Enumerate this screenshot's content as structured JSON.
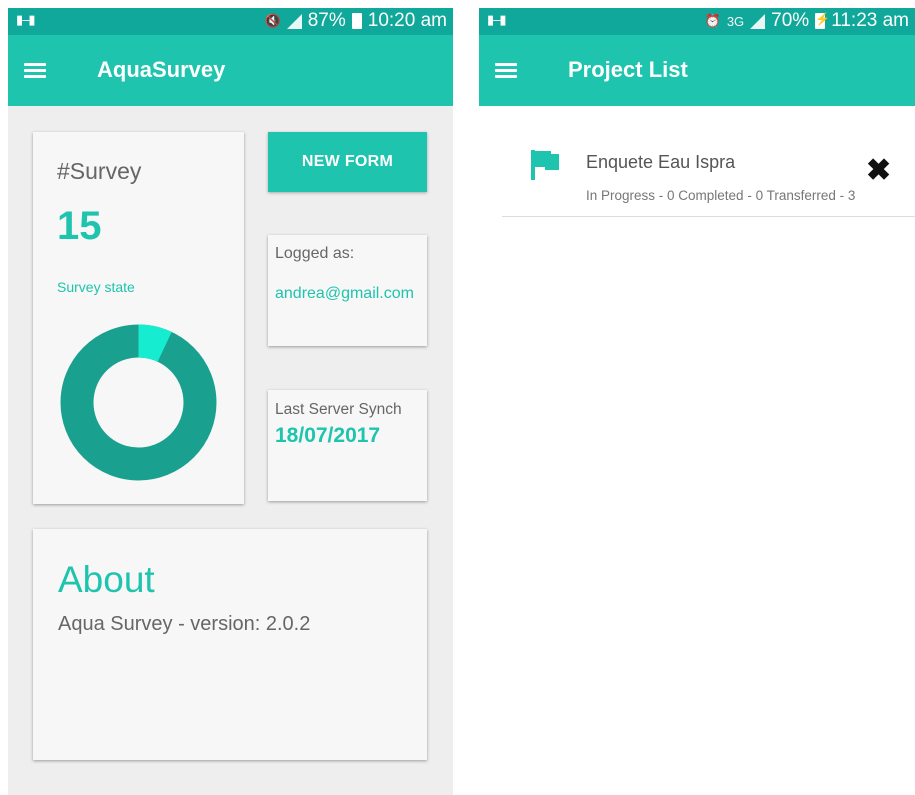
{
  "left_screen": {
    "status_bar": {
      "battery": "87%",
      "time": "10:20 am"
    },
    "app_bar": {
      "title": "AquaSurvey"
    },
    "survey_card": {
      "label": "#Survey",
      "count": "15",
      "state_label": "Survey state",
      "chart_fraction_highlight": 0.07
    },
    "new_form_label": "NEW FORM",
    "logged_card": {
      "label": "Logged as:",
      "email": "andrea@gmail.com"
    },
    "synch_card": {
      "label": "Last Server Synch",
      "date": "18/07/2017"
    },
    "about_card": {
      "title": "About",
      "version": "Aqua Survey - version: 2.0.2"
    }
  },
  "right_screen": {
    "status_bar": {
      "battery": "70%",
      "time": "11:23 am",
      "network": "3G"
    },
    "app_bar": {
      "title": "Project List"
    },
    "project": {
      "name": "Enquete Eau Ispra",
      "status": "In Progress - 0 Completed - 0 Transferred - 3"
    }
  },
  "colors": {
    "status_bar": "#0fa89a",
    "app_bar": "#1ec4ad",
    "donut_main": "#1aa08e",
    "donut_highlight": "#16ecd0"
  },
  "icons": [
    "menu-icon",
    "flag-icon",
    "close-icon",
    "battery-icon",
    "signal-icon",
    "alarm-icon"
  ]
}
